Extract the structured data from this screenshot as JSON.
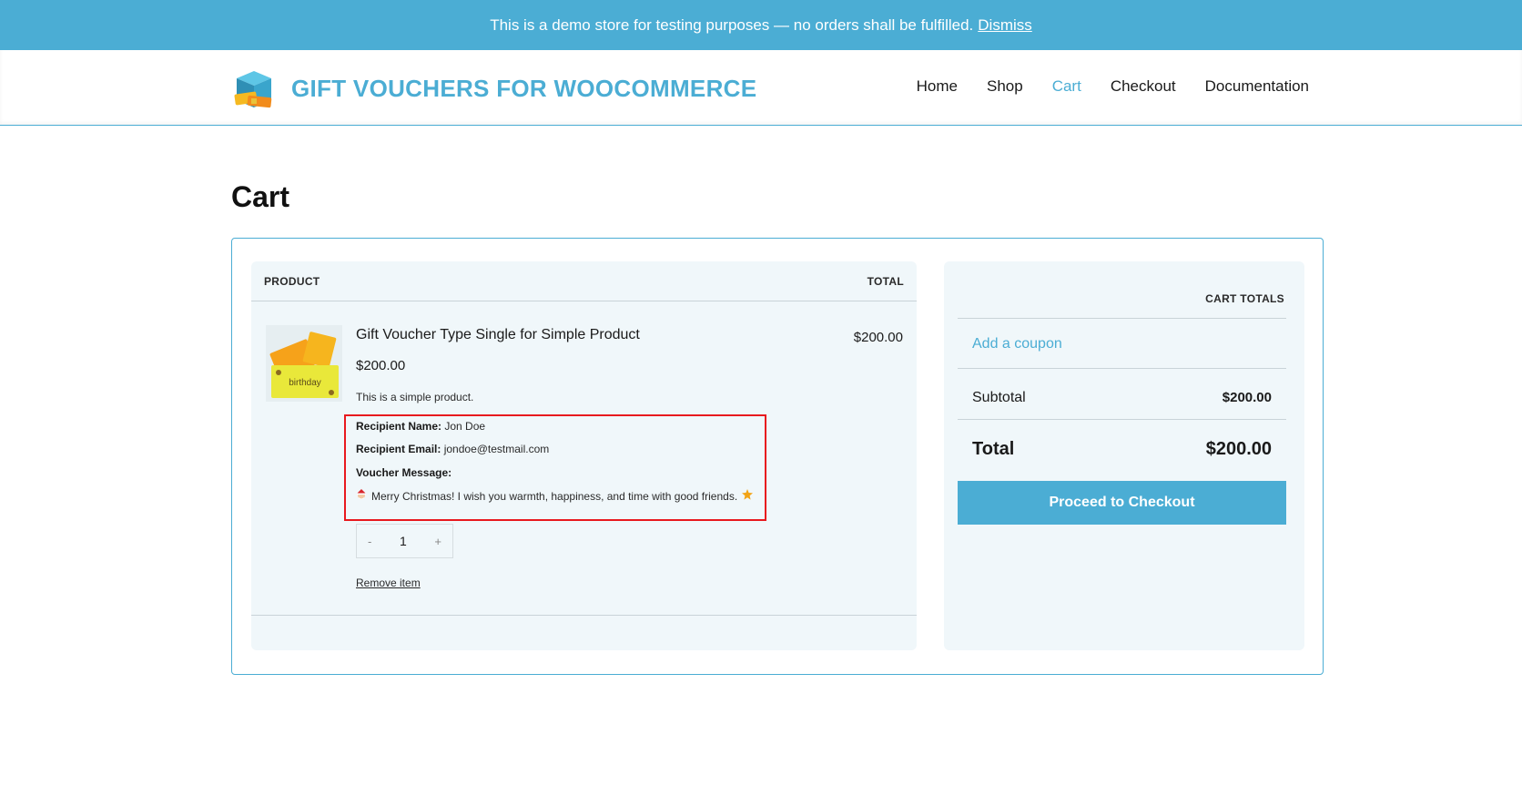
{
  "notice": {
    "text": "This is a demo store for testing purposes — no orders shall be fulfilled.",
    "dismiss": "Dismiss"
  },
  "header": {
    "site_title": "GIFT VOUCHERS FOR WOOCOMMERCE",
    "logo_icon": "gift-box-icon",
    "nav": [
      {
        "label": "Home"
      },
      {
        "label": "Shop"
      },
      {
        "label": "Cart",
        "active": true
      },
      {
        "label": "Checkout"
      },
      {
        "label": "Documentation"
      }
    ]
  },
  "page": {
    "title": "Cart"
  },
  "cart": {
    "col_product": "PRODUCT",
    "col_total": "TOTAL",
    "item": {
      "thumb_text": "birthday",
      "name": "Gift Voucher Type Single for Simple Product",
      "price": "$200.00",
      "description": "This is a simple product.",
      "recipient_name_label": "Recipient Name:",
      "recipient_name": "Jon Doe",
      "recipient_email_label": "Recipient Email:",
      "recipient_email": "jondoe@testmail.com",
      "message_label": "Voucher Message:",
      "message": "Merry Christmas! I wish you warmth, happiness, and time with good friends.",
      "quantity": "1",
      "qty_minus": "-",
      "qty_plus": "+",
      "remove": "Remove item",
      "line_total": "$200.00"
    }
  },
  "totals": {
    "heading": "CART TOTALS",
    "coupon": "Add a coupon",
    "subtotal_label": "Subtotal",
    "subtotal": "$200.00",
    "total_label": "Total",
    "total": "$200.00",
    "checkout": "Proceed to Checkout"
  },
  "colors": {
    "accent": "#4badd4",
    "highlight": "#e8191e",
    "panel": "#f0f7fa"
  }
}
